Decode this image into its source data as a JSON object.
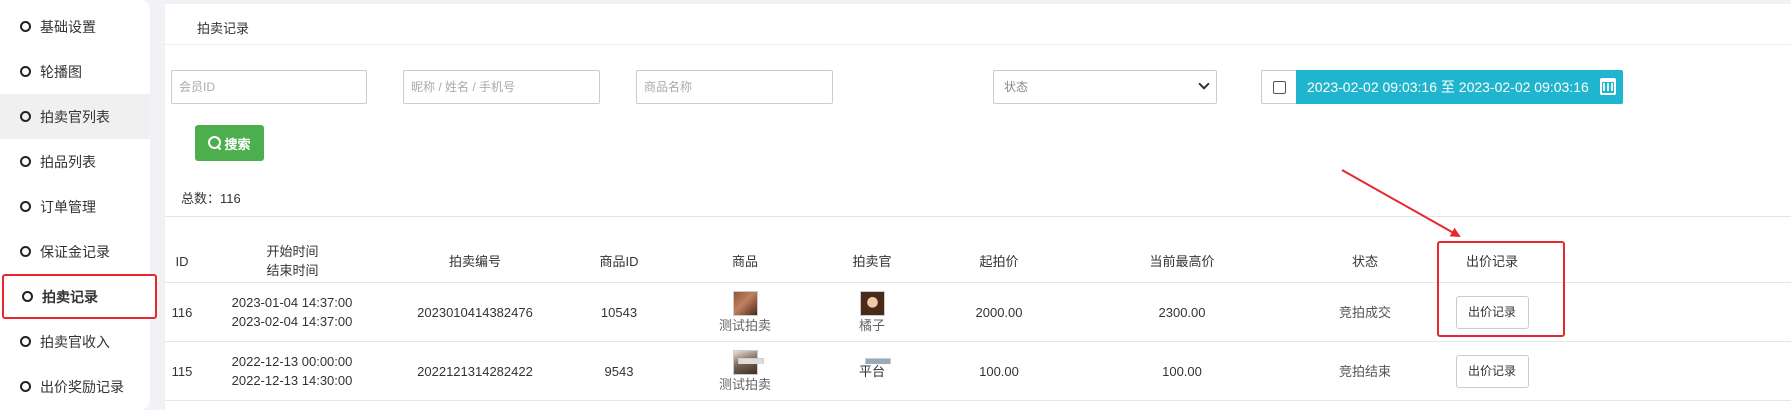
{
  "sidebar": {
    "items": [
      {
        "label": "基础设置"
      },
      {
        "label": "轮播图"
      },
      {
        "label": "拍卖官列表"
      },
      {
        "label": "拍品列表"
      },
      {
        "label": "订单管理"
      },
      {
        "label": "保证金记录"
      },
      {
        "label": "拍卖记录"
      },
      {
        "label": "拍卖官收入"
      },
      {
        "label": "出价奖励记录"
      }
    ],
    "active_label": "拍卖记录"
  },
  "panel": {
    "title": "拍卖记录"
  },
  "filters": {
    "member_id_placeholder": "会员ID",
    "name_placeholder": "昵称 / 姓名 / 手机号",
    "product_placeholder": "商品名称",
    "status_placeholder": "状态",
    "date_range": "2023-02-02 09:03:16 至 2023-02-02 09:03:16",
    "search_label": "搜索"
  },
  "total": "总数：116",
  "table": {
    "headers": {
      "id": "ID",
      "start_time": "开始时间",
      "end_time": "结束时间",
      "auction_no": "拍卖编号",
      "product_id": "商品ID",
      "product": "商品",
      "auctioneer": "拍卖官",
      "start_price": "起拍价",
      "highest_price": "当前最高价",
      "status": "状态",
      "bid_records": "出价记录"
    },
    "rows": [
      {
        "id": "116",
        "start_time": "2023-01-04 14:37:00",
        "end_time": "2023-02-04 14:37:00",
        "auction_no": "2023010414382476",
        "product_id": "10543",
        "product_name": "测试拍卖",
        "auctioneer": "橘子",
        "start_price": "2000.00",
        "highest_price": "2300.00",
        "status": "竞拍成交",
        "action": "出价记录"
      },
      {
        "id": "115",
        "start_time": "2022-12-13 00:00:00",
        "end_time": "2022-12-13 14:30:00",
        "auction_no": "2022121314282422",
        "product_id": "9543",
        "product_name": "测试拍卖",
        "auctioneer": "平台",
        "start_price": "100.00",
        "highest_price": "100.00",
        "status": "竞拍结束",
        "action": "出价记录"
      }
    ]
  },
  "colors": {
    "accent_cyan": "#1fb5cf",
    "search_green": "#4cae4c",
    "annotation_red": "#e8262b"
  }
}
